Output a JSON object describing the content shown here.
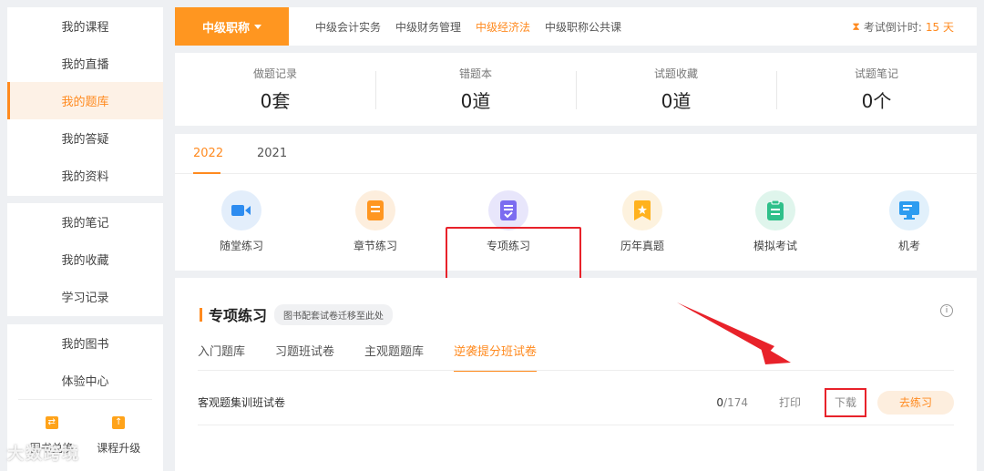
{
  "sidebar": {
    "group1": [
      "我的课程",
      "我的直播",
      "我的题库",
      "我的答疑",
      "我的资料"
    ],
    "group2": [
      "我的笔记",
      "我的收藏",
      "学习记录"
    ],
    "group3": [
      "我的图书",
      "体验中心"
    ],
    "bottom": [
      "图书兑换",
      "课程升级"
    ],
    "active": "我的题库"
  },
  "topnav": {
    "category": "中级职称",
    "subjects": [
      "中级会计实务",
      "中级财务管理",
      "中级经济法",
      "中级职称公共课"
    ],
    "active_subject": "中级经济法",
    "countdown_label": "考试倒计时:",
    "countdown_days": "15 天"
  },
  "stats": [
    {
      "label": "做题记录",
      "value": "0套"
    },
    {
      "label": "错题本",
      "value": "0道"
    },
    {
      "label": "试题收藏",
      "value": "0道"
    },
    {
      "label": "试题笔记",
      "value": "0个"
    }
  ],
  "years": [
    "2022",
    "2021"
  ],
  "tools": [
    {
      "label": "随堂练习",
      "icon": "video-icon",
      "bg": "#e3eefb",
      "color": "#2d8cf0"
    },
    {
      "label": "章节练习",
      "icon": "book-icon",
      "bg": "#fdeedd",
      "color": "#ff9620"
    },
    {
      "label": "专项练习",
      "icon": "document-icon",
      "bg": "#e8e6fb",
      "color": "#7b6cf0"
    },
    {
      "label": "历年真题",
      "icon": "bookmark-star-icon",
      "bg": "#fdf2de",
      "color": "#ffb21e"
    },
    {
      "label": "模拟考试",
      "icon": "clipboard-icon",
      "bg": "#dff5ec",
      "color": "#2fc08a"
    },
    {
      "label": "机考",
      "icon": "monitor-icon",
      "bg": "#e1f0fb",
      "color": "#2d9cf0"
    }
  ],
  "practice": {
    "title": "专项练习",
    "note": "图书配套试卷迁移至此处",
    "tabs": [
      "入门题库",
      "习题班试卷",
      "主观题题库",
      "逆袭提分班试卷"
    ],
    "active_tab": "逆袭提分班试卷",
    "row": {
      "name": "客观题集训班试卷",
      "done": "0",
      "total": "/174",
      "print": "打印",
      "download": "下载",
      "go": "去练习"
    }
  },
  "watermark": "大数跨境"
}
